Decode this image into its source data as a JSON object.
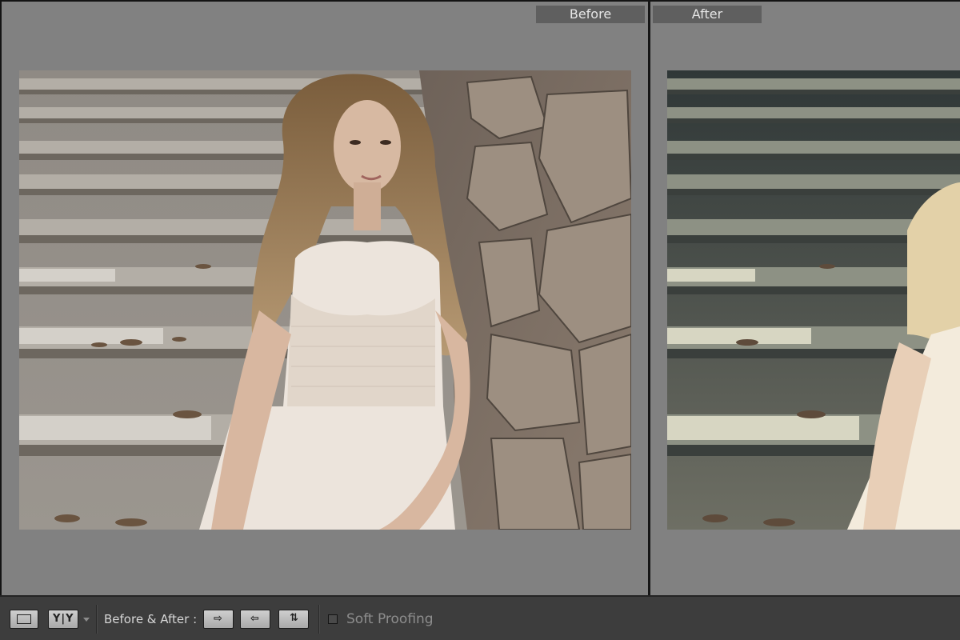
{
  "panes": {
    "before_label": "Before",
    "after_label": "After"
  },
  "toolbar": {
    "loupe_view_icon": "single-rectangle-icon",
    "before_after_view_label": "Y|Y",
    "before_after_label": "Before & After :",
    "copy_before_to_after_icon": "arrow-right-icon",
    "copy_after_to_before_icon": "arrow-left-icon",
    "swap_icon": "swap-vertical-icon",
    "soft_proofing_label": "Soft Proofing",
    "soft_proofing_checked": false
  },
  "colors": {
    "pane_bg": "#818181",
    "toolbar_bg": "#3d3d3d",
    "label_bg": "#5f5f5f"
  }
}
